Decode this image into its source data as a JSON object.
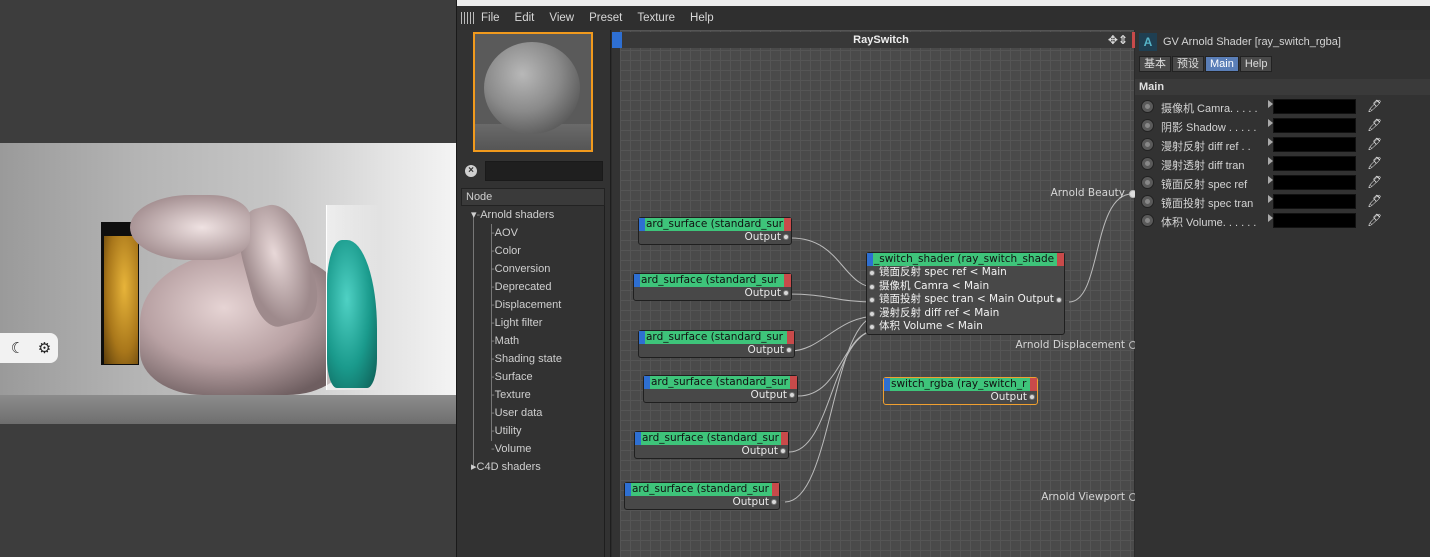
{
  "viewport": {
    "pill_icons": [
      "moon-icon",
      "gear-icon"
    ]
  },
  "menu": {
    "items": [
      "File",
      "Edit",
      "View",
      "Preset",
      "Texture",
      "Help"
    ]
  },
  "browser": {
    "search_value": "",
    "node_header": "Node",
    "tree": [
      {
        "label": "Arnold shaders",
        "level": 0
      },
      {
        "label": "AOV",
        "level": 1
      },
      {
        "label": "Color",
        "level": 1
      },
      {
        "label": "Conversion",
        "level": 1
      },
      {
        "label": "Deprecated",
        "level": 1
      },
      {
        "label": "Displacement",
        "level": 1
      },
      {
        "label": "Light filter",
        "level": 1
      },
      {
        "label": "Math",
        "level": 1
      },
      {
        "label": "Shading state",
        "level": 1
      },
      {
        "label": "Surface",
        "level": 1
      },
      {
        "label": "Texture",
        "level": 1
      },
      {
        "label": "User data",
        "level": 1
      },
      {
        "label": "Utility",
        "level": 1
      },
      {
        "label": "Volume",
        "level": 1
      },
      {
        "label": "C4D shaders",
        "level": 0
      }
    ]
  },
  "graph": {
    "title": "RaySwitch",
    "nodes": [
      {
        "title": "ard_surface (standard_sur",
        "output": "Output"
      },
      {
        "title": "ard_surface (standard_sur",
        "output": "Output"
      },
      {
        "title": "ard_surface (standard_sur",
        "output": "Output"
      },
      {
        "title": "ard_surface (standard_sur",
        "output": "Output"
      },
      {
        "title": "ard_surface (standard_sur",
        "output": "Output"
      },
      {
        "title": "ard_surface (standard_sur",
        "output": "Output"
      }
    ],
    "switch_node": {
      "title": "_switch_shader (ray_switch_shade",
      "inputs": [
        "镜面反射 spec ref < Main",
        "摄像机 Camra < Main",
        "镜面投射 spec tran < Main Output",
        "漫射反射 diff ref < Main",
        "体积 Volume < Main"
      ]
    },
    "rgba_node": {
      "title": "switch_rgba (ray_switch_r",
      "output": "Output"
    },
    "dock": {
      "beauty": "Arnold Beauty",
      "displacement": "Arnold Displacement",
      "viewport": "Arnold Viewport"
    }
  },
  "attributes": {
    "title": "GV Arnold Shader [ray_switch_rgba]",
    "tabs": [
      "基本",
      "预设",
      "Main",
      "Help"
    ],
    "active_tab": "Main",
    "section": "Main",
    "rows": [
      {
        "label": "摄像机 Camra. . . . ."
      },
      {
        "label": "阴影 Shadow . . . . ."
      },
      {
        "label": "漫射反射 diff ref  . ."
      },
      {
        "label": "漫射透射 diff tran"
      },
      {
        "label": "镜面反射 spec ref"
      },
      {
        "label": "镜面投射 spec tran"
      },
      {
        "label": "体积 Volume. . . . . ."
      }
    ]
  }
}
